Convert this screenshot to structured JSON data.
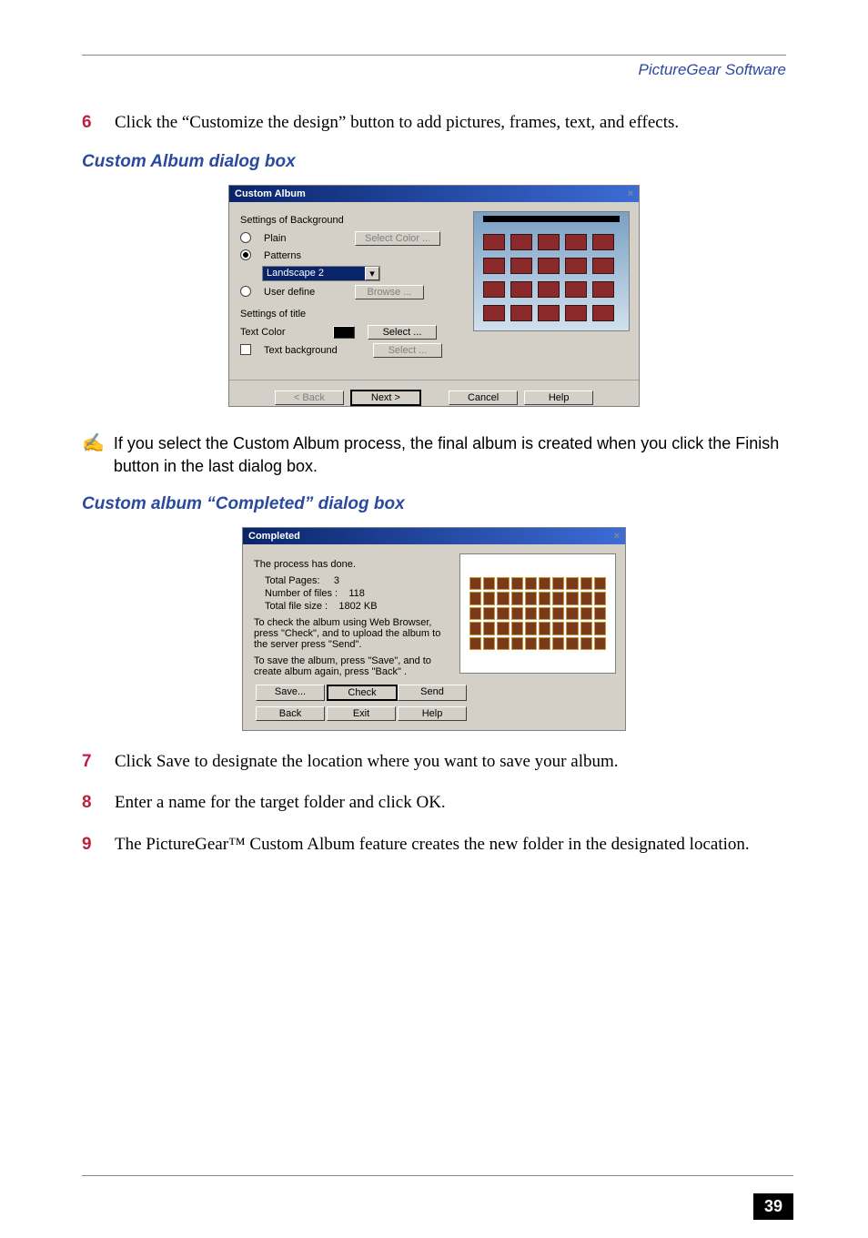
{
  "running_head": "PictureGear Software",
  "step6": {
    "num": "6",
    "text": "Click the “Customize the design” button to add pictures, frames, text, and effects."
  },
  "heading1": "Custom Album dialog box",
  "dlg1": {
    "title": "Custom Album",
    "group_bg": "Settings of Background",
    "radio_plain": "Plain",
    "btn_select_color": "Select Color ...",
    "radio_patterns": "Patterns",
    "combo_value": "Landscape 2",
    "radio_userdef": "User define",
    "btn_browse": "Browse ...",
    "group_title": "Settings of title",
    "lbl_textcolor": "Text Color",
    "btn_select": "Select ...",
    "chk_textbg": "Text background",
    "btn_select2": "Select ...",
    "btn_back": "< Back",
    "btn_next": "Next >",
    "btn_cancel": "Cancel",
    "btn_help": "Help"
  },
  "note_text": "If you select the Custom Album process, the final album is created when you click the Finish button in the last dialog box.",
  "heading2": "Custom album “Completed” dialog box",
  "dlg2": {
    "title": "Completed",
    "done": "The process has done.",
    "lbl_total_pages": "Total Pages:",
    "val_total_pages": "3",
    "lbl_num_files": "Number of files :",
    "val_num_files": "118",
    "lbl_total_size": "Total file size :",
    "val_total_size": "1802 KB",
    "para1": "To check the album using Web Browser, press \"Check\", and to upload the album to the server press \"Send\".",
    "para2": "To save the album, press \"Save\", and to create album again, press \"Back\" .",
    "btn_save": "Save...",
    "btn_check": "Check",
    "btn_send": "Send",
    "btn_back": "Back",
    "btn_exit": "Exit",
    "btn_help": "Help"
  },
  "step7": {
    "num": "7",
    "text": "Click Save to designate the location where you want to save your album."
  },
  "step8": {
    "num": "8",
    "text": "Enter a name for the target folder and click OK."
  },
  "step9": {
    "num": "9",
    "text": "The PictureGear™ Custom Album feature creates the new folder in the designated location."
  },
  "page_number": "39"
}
